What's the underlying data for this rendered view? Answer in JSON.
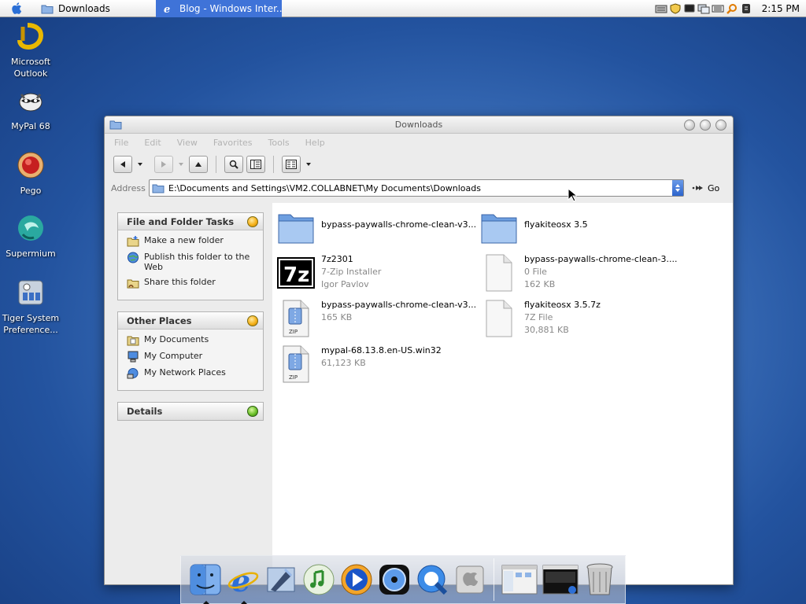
{
  "menubar": {
    "tasks": [
      {
        "label": "Downloads",
        "icon": "folder-icon",
        "active": false
      },
      {
        "label": "Blog - Windows Inter...",
        "icon": "ie-icon",
        "active": true
      }
    ],
    "clock": "2:15 PM"
  },
  "desktop": {
    "icons": [
      {
        "label": "Microsoft Outlook",
        "icon": "outlook-icon"
      },
      {
        "label": "MyPal 68",
        "icon": "mypal-icon"
      },
      {
        "label": "Pego",
        "icon": "pego-icon"
      },
      {
        "label": "Supermium",
        "icon": "supermium-icon"
      },
      {
        "label": "Tiger System Preference...",
        "icon": "system-preferences-icon"
      }
    ]
  },
  "window": {
    "title": "Downloads",
    "menu": [
      "File",
      "Edit",
      "View",
      "Favorites",
      "Tools",
      "Help"
    ],
    "address": {
      "label": "Address",
      "value": "E:\\Documents and Settings\\VM2.COLLABNET\\My Documents\\Downloads",
      "go_label": "Go"
    },
    "panels": {
      "tasks": {
        "title": "File and Folder Tasks",
        "items": [
          "Make a new folder",
          "Publish this folder to the Web",
          "Share this folder"
        ]
      },
      "places": {
        "title": "Other Places",
        "items": [
          "My Documents",
          "My Computer",
          "My Network Places"
        ]
      },
      "details": {
        "title": "Details"
      }
    },
    "files": [
      {
        "name": "bypass-paywalls-chrome-clean-v3...",
        "type": "folder",
        "sub1": "",
        "sub2": ""
      },
      {
        "name": "flyakiteosx 3.5",
        "type": "folder",
        "sub1": "",
        "sub2": ""
      },
      {
        "name": "7z2301",
        "type": "7z-installer",
        "sub1": "7-Zip Installer",
        "sub2": "Igor Pavlov"
      },
      {
        "name": "bypass-paywalls-chrome-clean-3....",
        "type": "blank-file",
        "sub1": "0 File",
        "sub2": "162 KB"
      },
      {
        "name": "bypass-paywalls-chrome-clean-v3...",
        "type": "zip",
        "sub1": "165 KB",
        "sub2": ""
      },
      {
        "name": "flyakiteosx 3.5.7z",
        "type": "blank-file",
        "sub1": "7Z File",
        "sub2": "30,881 KB"
      },
      {
        "name": "mypal-68.13.8.en-US.win32",
        "type": "zip",
        "sub1": "61,123 KB",
        "sub2": ""
      }
    ]
  },
  "dock": {
    "apps": [
      "finder-icon",
      "internet-explorer-icon",
      "mail-icon",
      "itunes-icon",
      "media-player-icon",
      "dvd-player-icon",
      "quicktime-icon",
      "system-preferences-icon"
    ],
    "windows": [
      "minimized-window-explorer-icon",
      "minimized-window-ie-icon"
    ],
    "trash": "trash-icon"
  }
}
